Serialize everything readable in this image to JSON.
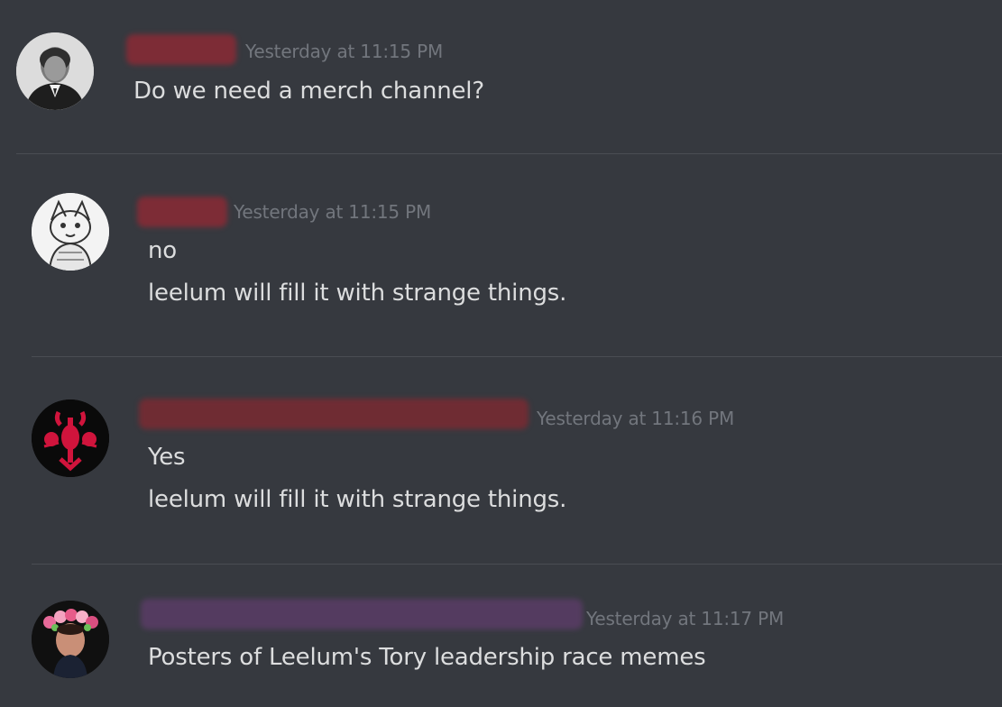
{
  "messages": [
    {
      "avatar_icon": "portrait-man-suit-icon",
      "timestamp": "Yesterday at 11:15 PM",
      "lines": [
        "Do we need a merch channel?"
      ]
    },
    {
      "avatar_icon": "sketched-cat-icon",
      "timestamp": "Yesterday at 11:15 PM",
      "lines": [
        "no",
        "leelum will fill it with strange things."
      ]
    },
    {
      "avatar_icon": "red-lobster-emblem-icon",
      "timestamp": "Yesterday at 11:16 PM",
      "lines": [
        "Yes",
        "leelum will fill it with strange things."
      ]
    },
    {
      "avatar_icon": "flower-crown-portrait-icon",
      "timestamp": "Yesterday at 11:17 PM",
      "lines": [
        "Posters of Leelum's Tory leadership race memes"
      ]
    }
  ],
  "colors": {
    "background": "#36393f",
    "text": "#dcddde",
    "timestamp": "#72767d",
    "redacted_red": "#8a2a35",
    "redacted_purple": "#5a3c66",
    "divider": "#4a4d53"
  }
}
